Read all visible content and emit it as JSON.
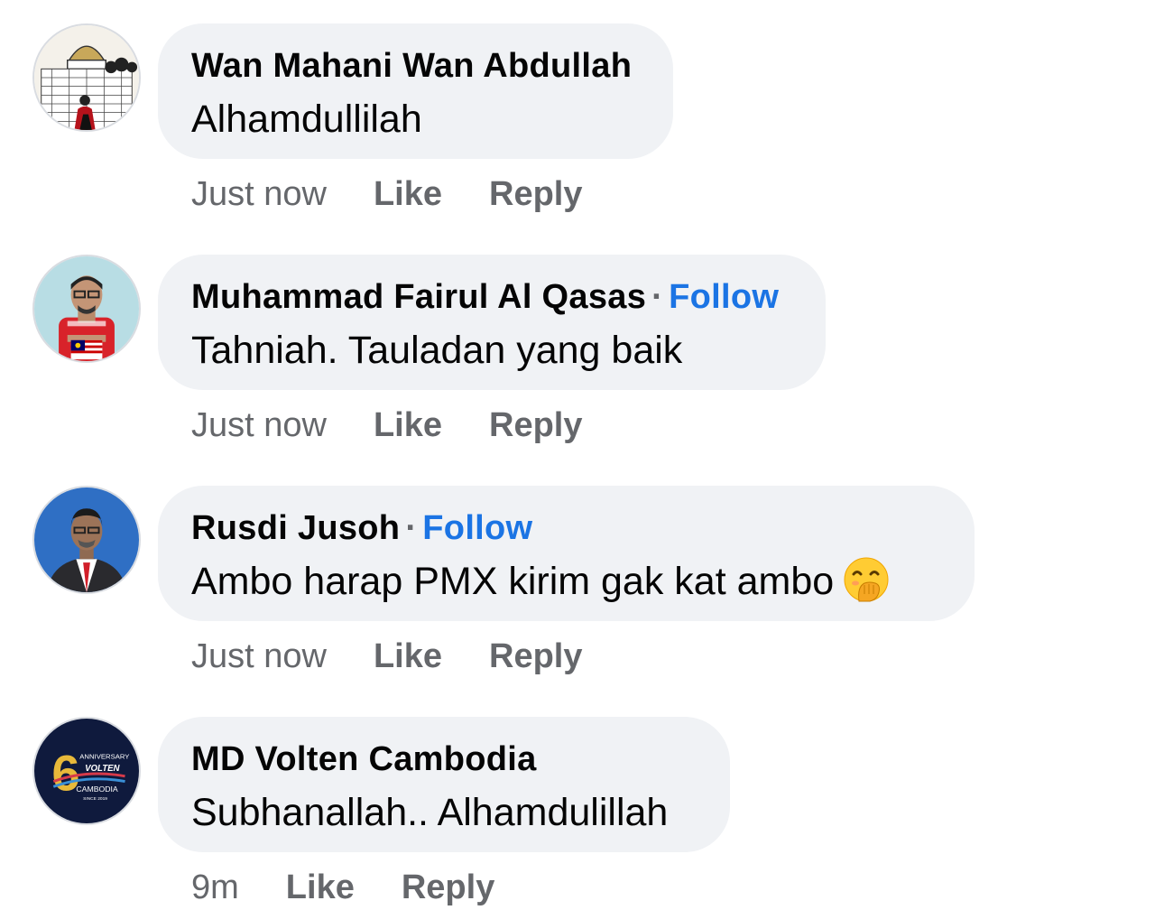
{
  "comments": [
    {
      "author": "Wan Mahani Wan Abdullah",
      "follow_label": "",
      "text": "Alhamdullilah",
      "time": "Just now",
      "like_label": "Like",
      "reply_label": "Reply",
      "avatar_icon": "mosque-illustration-avatar"
    },
    {
      "author": "Muhammad Fairul Al Qasas",
      "follow_label": "Follow",
      "text": "Tahniah. Tauladan yang baik",
      "time": "Just now",
      "like_label": "Like",
      "reply_label": "Reply",
      "avatar_icon": "man-red-shirt-avatar"
    },
    {
      "author": "Rusdi Jusoh",
      "follow_label": "Follow",
      "text": "Ambo harap PMX kirim gak kat ambo",
      "emoji": "face-with-hand-over-mouth",
      "time": "Just now",
      "like_label": "Like",
      "reply_label": "Reply",
      "avatar_icon": "man-suit-blue-background-avatar"
    },
    {
      "author": "MD Volten Cambodia",
      "follow_label": "",
      "text": "Subhanallah.. Alhamdulillah",
      "time": "9m",
      "like_label": "Like",
      "reply_label": "Reply",
      "avatar_icon": "volten-anniversary-logo-avatar",
      "avatar_logo_text": [
        "6",
        "ANNIVERSARY",
        "VOLTEN",
        "CAMBODIA",
        "SINCE 2019"
      ]
    }
  ],
  "colors": {
    "bubble": "#f0f2f5",
    "text": "#050505",
    "meta": "#65676b",
    "follow": "#1b74e4"
  }
}
